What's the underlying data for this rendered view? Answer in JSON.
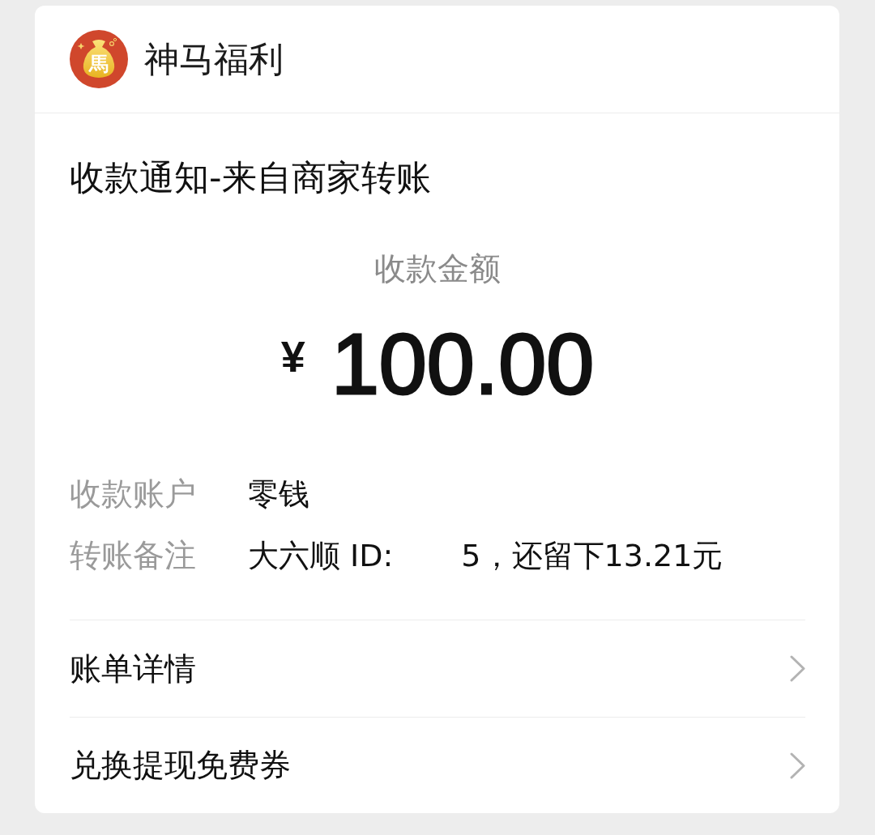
{
  "app": {
    "name": "神马福利",
    "logo_glyph": "馬"
  },
  "notice": {
    "title": "收款通知-来自商家转账",
    "amount_label": "收款金额",
    "currency": "¥",
    "amount": "100.00"
  },
  "details": [
    {
      "label": "收款账户",
      "value_parts": [
        "零钱"
      ]
    },
    {
      "label": "转账备注",
      "value_parts": [
        "大六顺 ID:",
        "5，还留下13.21元"
      ]
    }
  ],
  "links": [
    {
      "label": "账单详情"
    },
    {
      "label": "兑换提现免费券"
    }
  ]
}
